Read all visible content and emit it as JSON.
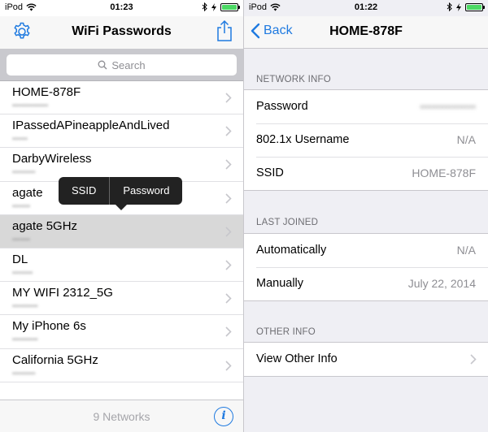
{
  "left": {
    "status": {
      "carrier": "iPod",
      "time": "01:23"
    },
    "nav": {
      "title": "WiFi Passwords"
    },
    "search": {
      "placeholder": "Search"
    },
    "networks": [
      {
        "name": "HOME-878F",
        "password": "••••••••••••••"
      },
      {
        "name": "IPassedAPineappleAndLived",
        "password": "••••••"
      },
      {
        "name": "DarbyWireless",
        "password": "•••••••••"
      },
      {
        "name": "agate",
        "password": "•••••••"
      },
      {
        "name": "agate 5GHz",
        "password": "•••••••"
      },
      {
        "name": "DL",
        "password": "••••••••"
      },
      {
        "name": "MY WIFI 2312_5G",
        "password": "••••••••••"
      },
      {
        "name": "My iPhone 6s",
        "password": "••••••••••"
      },
      {
        "name": "California 5GHz",
        "password": "•••••••••"
      }
    ],
    "tooltip": {
      "ssid": "SSID",
      "password": "Password"
    },
    "toolbar": {
      "count": "9 Networks",
      "info": "i"
    }
  },
  "right": {
    "status": {
      "carrier": "iPod",
      "time": "01:22"
    },
    "nav": {
      "back": "Back",
      "title": "HOME-878F"
    },
    "sections": {
      "network_info": {
        "header": "NETWORK INFO",
        "password_label": "Password",
        "password_value": "••••••••••••••",
        "username_label": "802.1x Username",
        "username_value": "N/A",
        "ssid_label": "SSID",
        "ssid_value": "HOME-878F"
      },
      "last_joined": {
        "header": "LAST JOINED",
        "auto_label": "Automatically",
        "auto_value": "N/A",
        "manual_label": "Manually",
        "manual_value": "July 22, 2014"
      },
      "other_info": {
        "header": "OTHER INFO",
        "view_label": "View Other Info"
      }
    }
  },
  "colors": {
    "accent": "#1f7ae0",
    "battery": "#4cd964",
    "selected_row": "#d8d8d8"
  }
}
